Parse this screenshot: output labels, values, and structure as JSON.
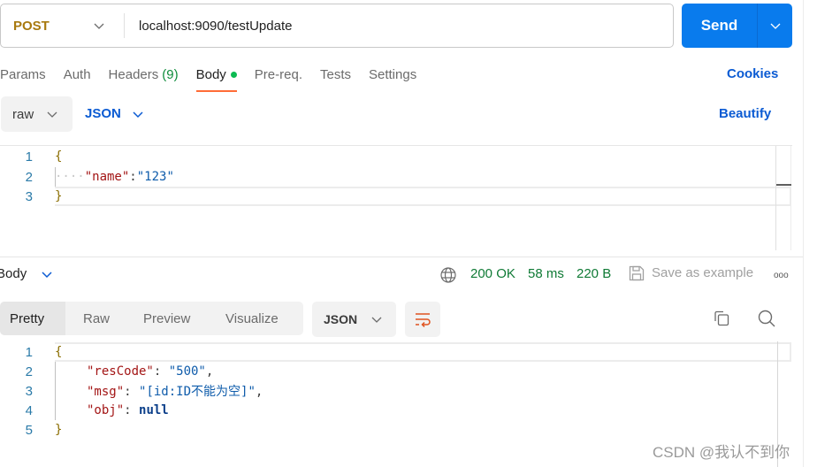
{
  "request": {
    "method": "POST",
    "url": "localhost:9090/testUpdate",
    "send_label": "Send"
  },
  "request_tabs": [
    {
      "label": "Params"
    },
    {
      "label": "Auth"
    },
    {
      "label": "Headers",
      "count": "(9)"
    },
    {
      "label": "Body",
      "active": true
    },
    {
      "label": "Pre-req."
    },
    {
      "label": "Tests"
    },
    {
      "label": "Settings"
    }
  ],
  "cookies_label": "Cookies",
  "body_type": {
    "mode": "raw",
    "format": "JSON",
    "beautify_label": "Beautify"
  },
  "request_body": {
    "line_numbers": [
      "1",
      "2",
      "3"
    ],
    "lines": {
      "l1": "{",
      "l2_ws": "····",
      "l2_key": "\"name\"",
      "l2_colon": ":",
      "l2_val": "\"123\"",
      "l3": "}"
    }
  },
  "response": {
    "section_label": "Body",
    "status": "200 OK",
    "time": "58 ms",
    "size": "220 B",
    "save_example_label": "Save as example",
    "more_label": "ooo",
    "view_tabs": [
      {
        "label": "Pretty",
        "active": true
      },
      {
        "label": "Raw"
      },
      {
        "label": "Preview"
      },
      {
        "label": "Visualize"
      }
    ],
    "format": "JSON",
    "line_numbers": [
      "1",
      "2",
      "3",
      "4",
      "5"
    ],
    "lines": {
      "l1": "{",
      "l2_key": "\"resCode\"",
      "l2_val": "\"500\"",
      "l3_key": "\"msg\"",
      "l3_val": "\"[id:ID不能为空]\"",
      "l4_key": "\"obj\"",
      "l4_val": "null",
      "l5": "}"
    }
  },
  "watermark": "CSDN @我认不到你",
  "colors": {
    "accent_send": "#097bed",
    "tab_underline": "#ff6c37",
    "status_green": "#0f7a35",
    "method_post": "#a8790e",
    "link_blue": "#0b5bd3"
  }
}
